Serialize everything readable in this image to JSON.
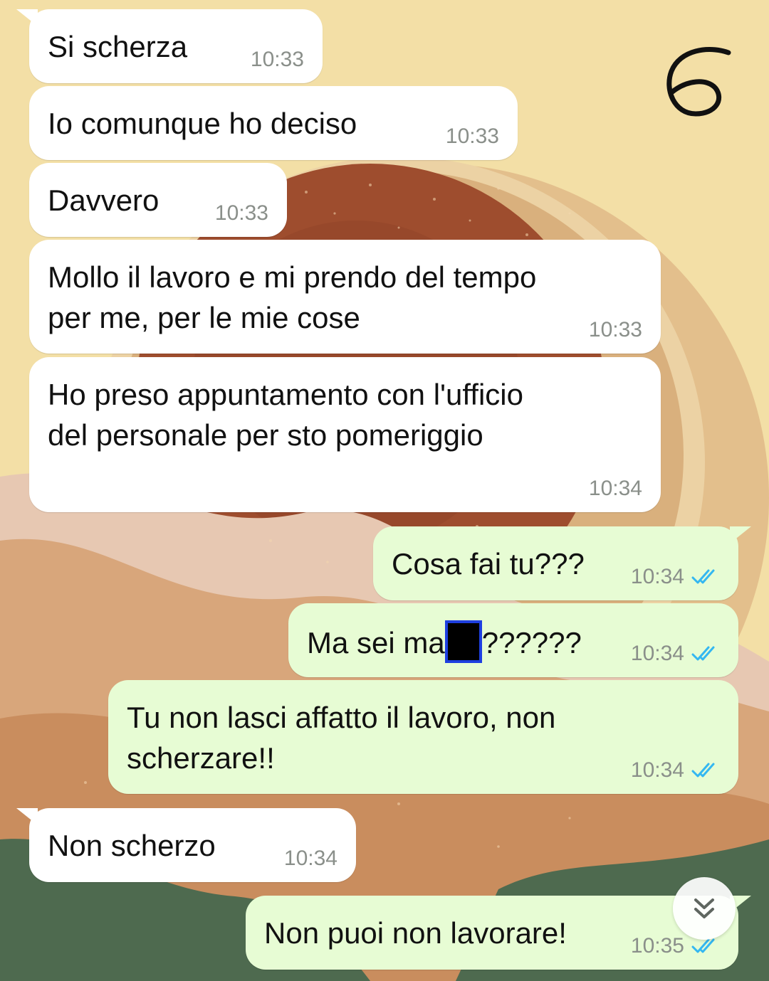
{
  "colors": {
    "incoming_bubble": "#ffffff",
    "outgoing_bubble": "#e7fcd4",
    "read_ticks": "#34b7f1",
    "timestamp": "#8a8f8a"
  },
  "page_mark": "6",
  "messages": [
    {
      "direction": "in",
      "text": "Si scherza",
      "time": "10:33"
    },
    {
      "direction": "in",
      "text": "Io comunque ho deciso",
      "time": "10:33"
    },
    {
      "direction": "in",
      "text": "Davvero",
      "time": "10:33"
    },
    {
      "direction": "in",
      "text": "Mollo il lavoro e mi prendo del tempo\nper me, per le mie cose",
      "time": "10:33"
    },
    {
      "direction": "in",
      "text": "Ho preso appuntamento con l'ufficio\ndel personale per sto pomeriggio",
      "time": "10:34"
    },
    {
      "direction": "out",
      "text": "Cosa fai tu???",
      "time": "10:34",
      "status": "read"
    },
    {
      "direction": "out",
      "text_before": "Ma sei ma",
      "text_after": "??????",
      "time": "10:34",
      "status": "read",
      "redacted": true
    },
    {
      "direction": "out",
      "text": "Tu non lasci affatto il lavoro, non\nscherzare!!",
      "time": "10:34",
      "status": "read"
    },
    {
      "direction": "in",
      "text": "Non scherzo",
      "time": "10:34"
    },
    {
      "direction": "out",
      "text": "Non puoi non lavorare!",
      "time": "10:35",
      "status": "read"
    }
  ],
  "scroll_to_bottom_icon": "double-chevron-down-icon"
}
